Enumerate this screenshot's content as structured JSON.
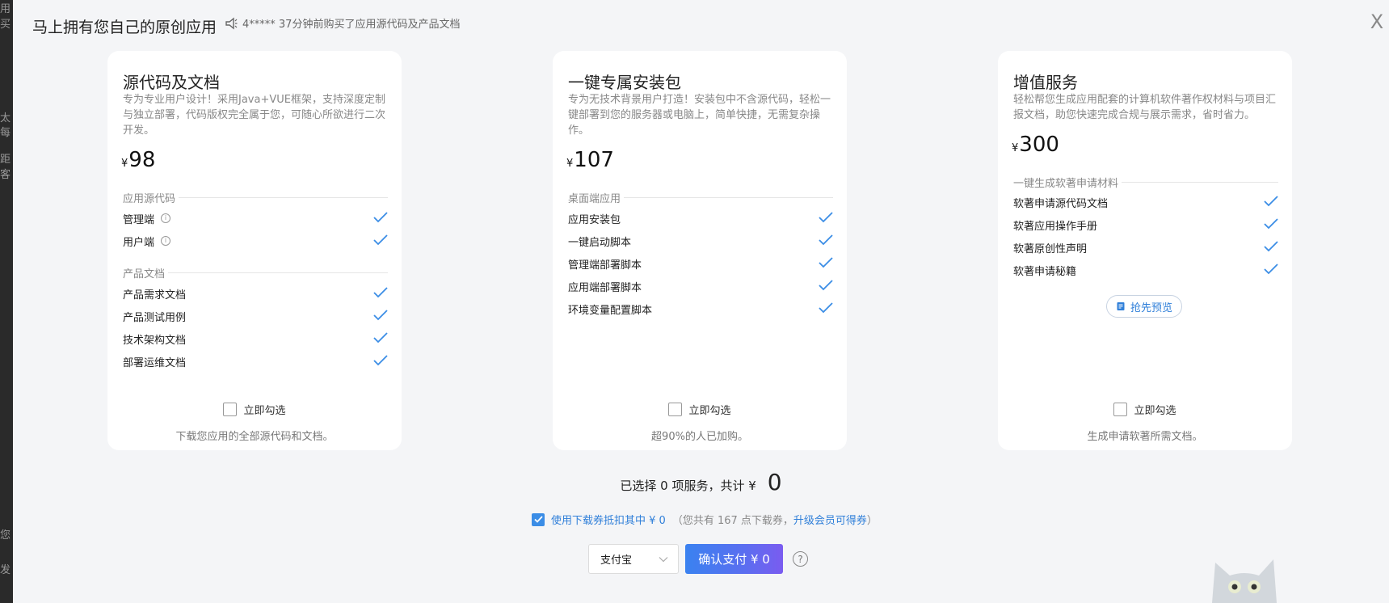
{
  "background": {
    "edge_text": [
      "用买",
      "太",
      "每",
      "距",
      "客",
      "您",
      "发"
    ]
  },
  "header": {
    "title": "马上拥有您自己的原创应用",
    "notice_icon": "megaphone-icon",
    "notice": "4***** 37分钟前购买了应用源代码及产品文档",
    "close_label": "X"
  },
  "cards": [
    {
      "title": "源代码及文档",
      "desc": "专为专业用户设计！采用Java+VUE框架，支持深度定制与独立部署，代码版权完全属于您，可随心所欲进行二次开发。",
      "currency": "¥",
      "price": "98",
      "sections": [
        {
          "head": "应用源代码",
          "items": [
            "管理端",
            "用户端"
          ]
        },
        {
          "head": "产品文档",
          "items": [
            "产品需求文档",
            "产品测试用例",
            "技术架构文档",
            "部署运维文档"
          ]
        }
      ],
      "select_label": "立即勾选",
      "footer": "下载您应用的全部源代码和文档。"
    },
    {
      "title": "一键专属安装包",
      "desc": "专为无技术背景用户打造！安装包中不含源代码，轻松一键部署到您的服务器或电脑上，简单快捷，无需复杂操作。",
      "currency": "¥",
      "price": "107",
      "sections": [
        {
          "head": "桌面端应用",
          "items": [
            "应用安装包",
            "一键启动脚本",
            "管理端部署脚本",
            "应用端部署脚本",
            "环境变量配置脚本"
          ]
        }
      ],
      "select_label": "立即勾选",
      "footer": "超90%的人已加购。"
    },
    {
      "title": "增值服务",
      "desc": "轻松帮您生成应用配套的计算机软件著作权材料与项目汇报文档，助您快速完成合规与展示需求，省时省力。",
      "currency": "¥",
      "price": "300",
      "sections": [
        {
          "head": "一键生成软著申请材料",
          "items": [
            "软著申请源代码文档",
            "软著应用操作手册",
            "软著原创性声明",
            "软著申请秘籍"
          ]
        }
      ],
      "preview_label": "抢先预览",
      "select_label": "立即勾选",
      "footer": "生成申请软著所需文档。"
    }
  ],
  "summary": {
    "text": "已选择 0 项服务，共计 ¥",
    "total": "0"
  },
  "coupon": {
    "checked": true,
    "label": "使用下载券抵扣其中 ¥ 0",
    "note": "（您共有 167 点下载券，",
    "link": "升级会员可得券",
    "close": "）"
  },
  "payment": {
    "method": "支付宝",
    "confirm_label": "确认支付 ¥ 0",
    "help": "?"
  },
  "colors": {
    "accent": "#2f7fd9",
    "check": "#3b8de6"
  }
}
